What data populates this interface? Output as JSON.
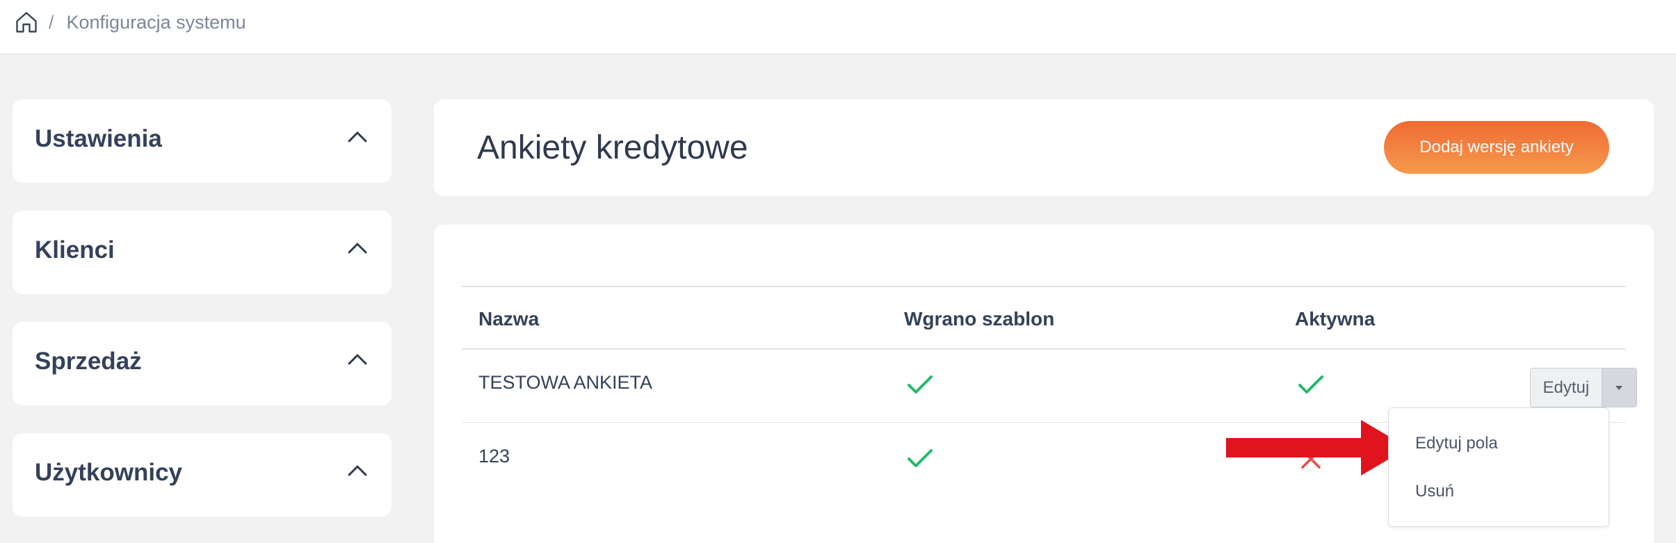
{
  "breadcrumb": {
    "home_icon": "home-icon",
    "separator": "/",
    "current": "Konfiguracja systemu"
  },
  "sidebar": {
    "sections": [
      {
        "label": "Ustawienia",
        "icon": "chevron-up-icon"
      },
      {
        "label": "Klienci",
        "icon": "chevron-up-icon"
      },
      {
        "label": "Sprzedaż",
        "icon": "chevron-up-icon"
      },
      {
        "label": "Użytkownicy",
        "icon": "chevron-up-icon"
      }
    ]
  },
  "header": {
    "title": "Ankiety kredytowe",
    "add_button": "Dodaj wersję ankiety"
  },
  "table": {
    "columns": [
      "Nazwa",
      "Wgrano szablon",
      "Aktywna"
    ],
    "rows": [
      {
        "name": "TESTOWA ANKIETA",
        "template_uploaded": true,
        "active": true
      },
      {
        "name": "123",
        "template_uploaded": true,
        "active": false
      }
    ],
    "row_action": {
      "label": "Edytuj",
      "toggle_icon": "caret-down-icon"
    }
  },
  "dropdown": {
    "items": [
      "Edytuj pola",
      "Usuń"
    ]
  },
  "colors": {
    "accent_start": "#f06a35",
    "accent_end": "#f59a4c",
    "check": "#22bb66",
    "cross": "#e84a4a",
    "annotation_arrow": "#e0141e"
  }
}
